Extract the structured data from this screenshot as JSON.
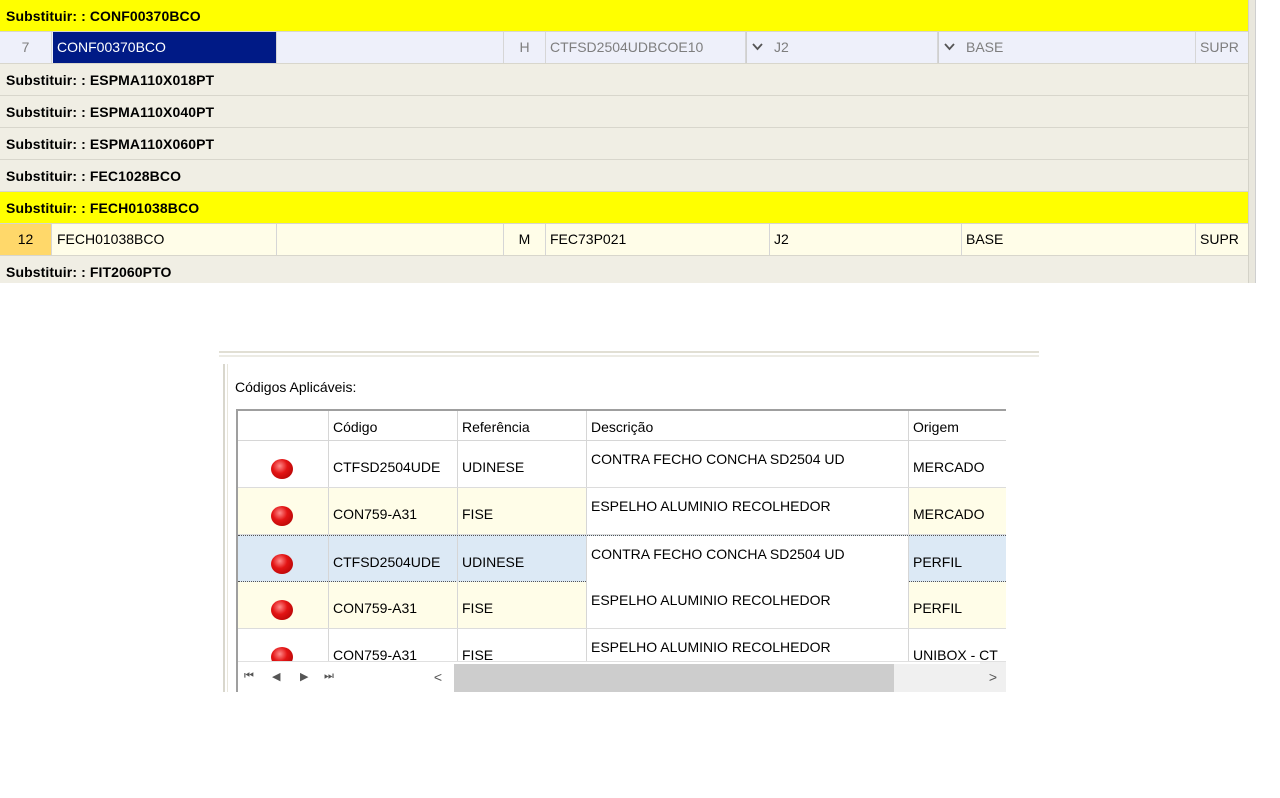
{
  "top_grid": {
    "groups": [
      {
        "label": "Substituir: : CONF00370BCO"
      },
      {
        "label": "Substituir: : ESPMA110X018PT"
      },
      {
        "label": "Substituir: : ESPMA110X040PT"
      },
      {
        "label": "Substituir: : ESPMA110X060PT"
      },
      {
        "label": "Substituir: : FEC1028BCO"
      },
      {
        "label": "Substituir: : FECH01038BCO"
      },
      {
        "label": "Substituir: : FIT2060PTO"
      }
    ],
    "rows": [
      {
        "index": "7",
        "code": "CONF00370BCO",
        "type": "H",
        "ref": "CTFSD2504UDBCOE10",
        "col_j": "J2",
        "base": "BASE",
        "supr": "SUPR"
      },
      {
        "index": "12",
        "code": "FECH01038BCO",
        "type": "M",
        "ref": "FEC73P021",
        "col_j": "J2",
        "base": "BASE",
        "supr": "SUPR"
      }
    ]
  },
  "panel": {
    "title": "Códigos Aplicáveis:",
    "columns": [
      "Código",
      "Referência",
      "Descrição",
      "Origem"
    ],
    "rows": [
      {
        "status": "red",
        "codigo": "CTFSD2504UDE",
        "referencia": "UDINESE",
        "descricao": "CONTRA FECHO CONCHA SD2504 UD",
        "origem": "MERCADO"
      },
      {
        "status": "red",
        "codigo": "CON759-A31",
        "referencia": "FISE",
        "descricao": "ESPELHO ALUMINIO RECOLHEDOR",
        "origem": "MERCADO"
      },
      {
        "status": "red",
        "codigo": "CTFSD2504UDE",
        "referencia": "UDINESE",
        "descricao": "CONTRA FECHO CONCHA SD2504 UD",
        "origem": "PERFIL"
      },
      {
        "status": "red",
        "codigo": "CON759-A31",
        "referencia": "FISE",
        "descricao": "ESPELHO ALUMINIO RECOLHEDOR",
        "origem": "PERFIL"
      },
      {
        "status": "red",
        "codigo": "CON759-A31",
        "referencia": "FISE",
        "descricao": "ESPELHO ALUMINIO RECOLHEDOR",
        "origem": "UNIBOX - CT"
      }
    ],
    "pager": {
      "first": "⏮",
      "prev": "◀",
      "next": "▶",
      "last": "⏭",
      "scroll_left": "<",
      "scroll_right": ">"
    }
  },
  "colors": {
    "highlight": "#ffff00",
    "selected_cell": "#001a86",
    "status_red": "#e31414",
    "row_alt": "#fffde8"
  }
}
